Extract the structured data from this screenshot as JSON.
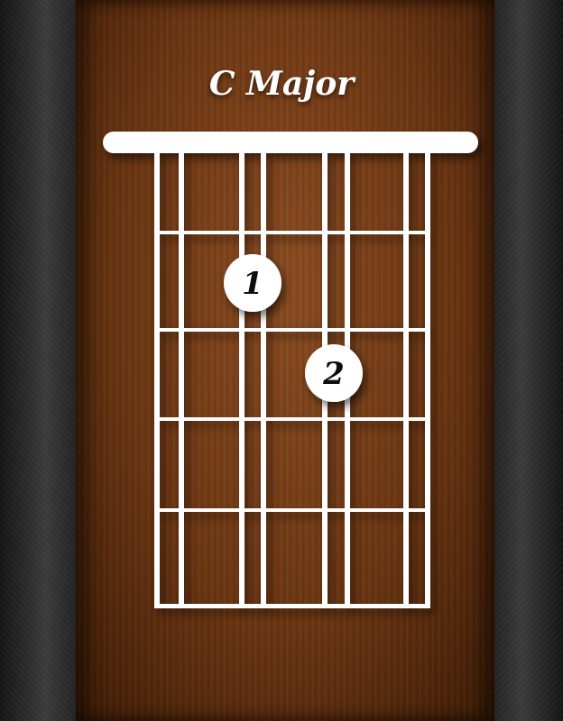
{
  "chord": {
    "name": "C Major"
  },
  "fingers": [
    {
      "label": "1",
      "string": 3,
      "fret": 1
    },
    {
      "label": "2",
      "string": 4,
      "fret": 2
    }
  ],
  "diagram": {
    "strings": 6,
    "frets": 5,
    "color": "#ffffff",
    "wood_color": "#6a3512"
  }
}
